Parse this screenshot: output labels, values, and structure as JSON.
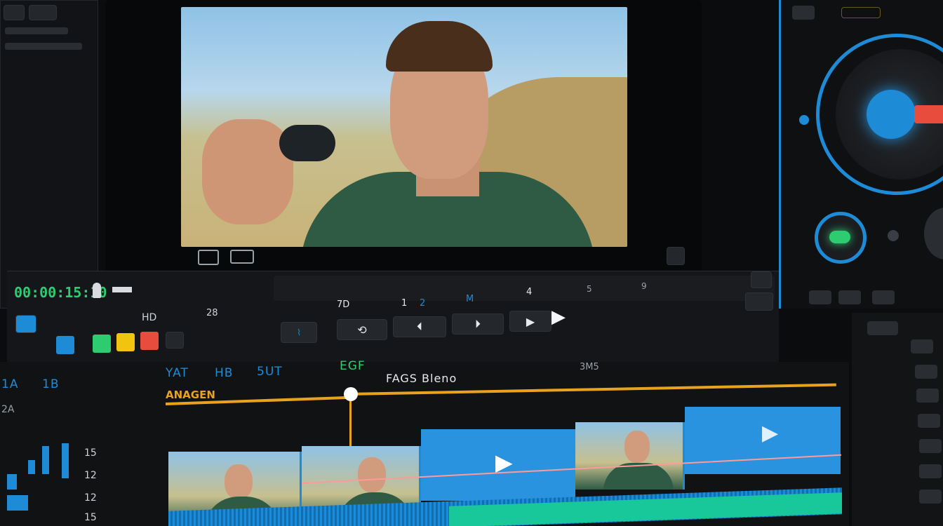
{
  "timecode_main": "00:00:15:10",
  "ruler_labels": [
    "7D",
    "1",
    "2",
    "M",
    "4",
    "5",
    "9"
  ],
  "panel_labels": {
    "left": "HD",
    "left2": "28"
  },
  "track_labels": [
    "YAT",
    "HB",
    "5UT",
    "EGF"
  ],
  "track_label_2": "ANAGEN",
  "timeline_title": "FAGS Bleno",
  "timeline_marker": "3M5",
  "left_tree": [
    "1A",
    "1B",
    "2A"
  ],
  "row_labels": [
    "15",
    "12",
    "12",
    "15"
  ],
  "colors": {
    "accent_blue": "#1e8bd6",
    "accent_yellow": "#e8a21e",
    "green": "#2ecc71",
    "yellow": "#f1c40f",
    "red": "#e74c3c"
  }
}
